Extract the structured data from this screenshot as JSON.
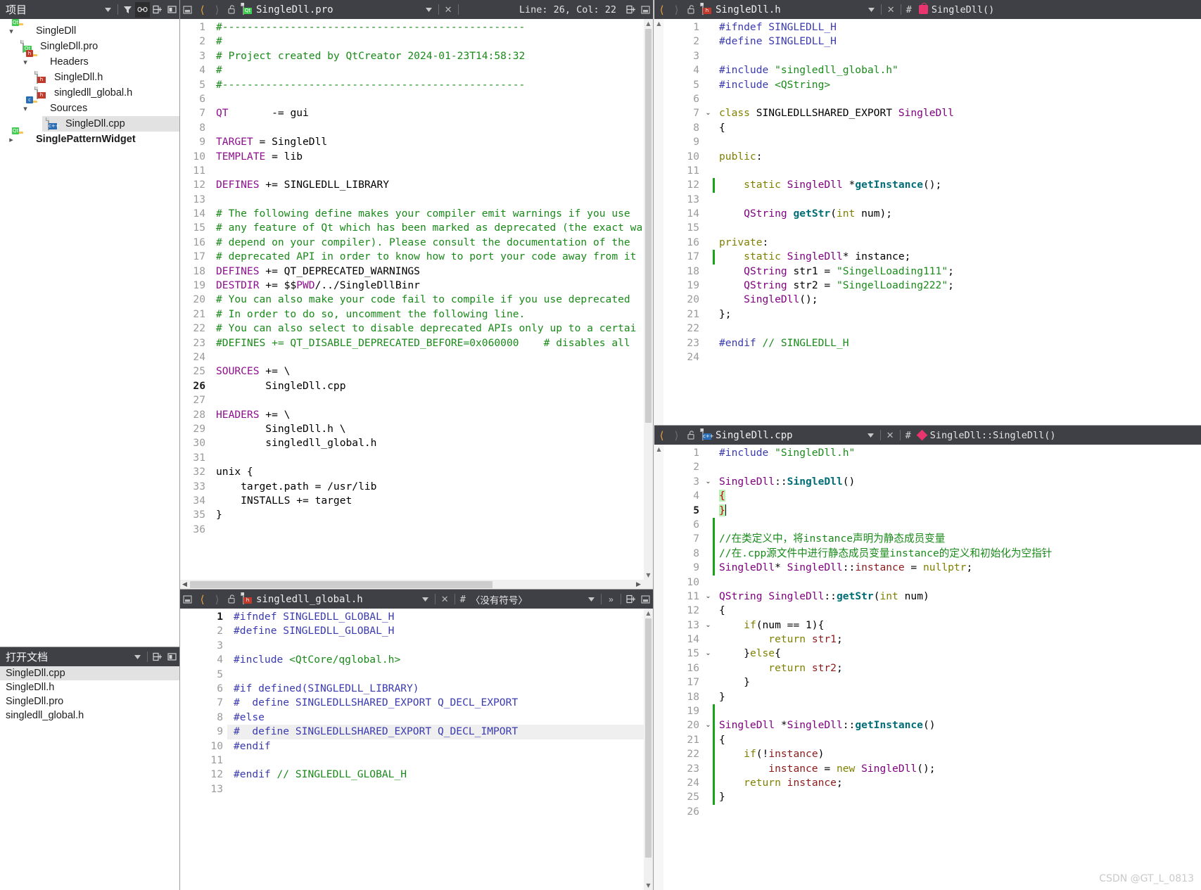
{
  "sidebar": {
    "title": "项目",
    "toolbar": [
      "chevron-down-icon",
      "filter-icon",
      "link-icon",
      "split-icon",
      "collapse-icon"
    ],
    "tree": [
      {
        "label": "SingleDll",
        "depth": 0,
        "caret": "v",
        "icon": "folder-qt",
        "selected": false,
        "bold": false
      },
      {
        "label": "SingleDll.pro",
        "depth": 1,
        "caret": "",
        "icon": "file-qt",
        "selected": false,
        "bold": false
      },
      {
        "label": "Headers",
        "depth": 1,
        "caret": "v",
        "icon": "folder-h",
        "selected": false,
        "bold": false
      },
      {
        "label": "SingleDll.h",
        "depth": 2,
        "caret": "",
        "icon": "file-h",
        "selected": false,
        "bold": false
      },
      {
        "label": "singledll_global.h",
        "depth": 2,
        "caret": "",
        "icon": "file-h",
        "selected": false,
        "bold": false
      },
      {
        "label": "Sources",
        "depth": 1,
        "caret": "v",
        "icon": "folder-cpp",
        "selected": false,
        "bold": false
      },
      {
        "label": "SingleDll.cpp",
        "depth": 2,
        "caret": "",
        "icon": "file-cpp",
        "selected": true,
        "bold": false
      },
      {
        "label": "SinglePatternWidget",
        "depth": 0,
        "caret": ">",
        "icon": "folder-qt",
        "selected": false,
        "bold": true
      }
    ]
  },
  "opendocs": {
    "title": "打开文档",
    "toolbar": [
      "chevron-down-icon",
      "split-icon"
    ],
    "items": [
      {
        "label": "SingleDll.cpp",
        "selected": true
      },
      {
        "label": "SingleDll.h",
        "selected": false
      },
      {
        "label": "SingleDll.pro",
        "selected": false
      },
      {
        "label": "singledll_global.h",
        "selected": false
      }
    ]
  },
  "editors": {
    "pro": {
      "filename": "SingleDll.pro",
      "icon": "qt-file-icon",
      "status": "Line: 26, Col: 22",
      "current_line": 26,
      "lines": [
        {
          "n": 1,
          "html": "<span class='c-cmt'>#-------------------------------------------------</span>"
        },
        {
          "n": 2,
          "html": "<span class='c-cmt'>#</span>"
        },
        {
          "n": 3,
          "html": "<span class='c-cmt'># Project created by QtCreator 2024-01-23T14:58:32</span>"
        },
        {
          "n": 4,
          "html": "<span class='c-cmt'>#</span>"
        },
        {
          "n": 5,
          "html": "<span class='c-cmt'>#-------------------------------------------------</span>"
        },
        {
          "n": 6,
          "html": ""
        },
        {
          "n": 7,
          "html": "<span class='c-pro'>QT</span>       -= gui"
        },
        {
          "n": 8,
          "html": ""
        },
        {
          "n": 9,
          "html": "<span class='c-pro'>TARGET</span> = SingleDll"
        },
        {
          "n": 10,
          "html": "<span class='c-pro'>TEMPLATE</span> = lib"
        },
        {
          "n": 11,
          "html": ""
        },
        {
          "n": 12,
          "html": "<span class='c-pro'>DEFINES</span> += SINGLEDLL_LIBRARY"
        },
        {
          "n": 13,
          "html": ""
        },
        {
          "n": 14,
          "html": "<span class='c-cmt'># The following define makes your compiler emit warnings if you use</span>"
        },
        {
          "n": 15,
          "html": "<span class='c-cmt'># any feature of Qt which has been marked as deprecated (the exact wa</span>"
        },
        {
          "n": 16,
          "html": "<span class='c-cmt'># depend on your compiler). Please consult the documentation of the</span>"
        },
        {
          "n": 17,
          "html": "<span class='c-cmt'># deprecated API in order to know how to port your code away from it</span>"
        },
        {
          "n": 18,
          "html": "<span class='c-pro'>DEFINES</span> += QT_DEPRECATED_WARNINGS"
        },
        {
          "n": 19,
          "html": "<span class='c-pro'>DESTDIR</span> += $$<span class='c-pro'>PWD</span>/../SingleDllBinr"
        },
        {
          "n": 20,
          "html": "<span class='c-cmt'># You can also make your code fail to compile if you use deprecated </span>"
        },
        {
          "n": 21,
          "html": "<span class='c-cmt'># In order to do so, uncomment the following line.</span>"
        },
        {
          "n": 22,
          "html": "<span class='c-cmt'># You can also select to disable deprecated APIs only up to a certai</span>"
        },
        {
          "n": 23,
          "html": "<span class='c-cmt'>#DEFINES += QT_DISABLE_DEPRECATED_BEFORE=0x060000    # disables all </span>"
        },
        {
          "n": 24,
          "html": ""
        },
        {
          "n": 25,
          "html": "<span class='c-pro'>SOURCES</span> += \\"
        },
        {
          "n": 26,
          "html": "        SingleDll.cpp"
        },
        {
          "n": 27,
          "html": ""
        },
        {
          "n": 28,
          "html": "<span class='c-pro'>HEADERS</span> += \\"
        },
        {
          "n": 29,
          "html": "        SingleDll.h \\"
        },
        {
          "n": 30,
          "html": "        singledll_global.h"
        },
        {
          "n": 31,
          "html": ""
        },
        {
          "n": 32,
          "html": "unix {"
        },
        {
          "n": 33,
          "html": "    target.path = /usr/lib"
        },
        {
          "n": 34,
          "html": "    INSTALLS += target"
        },
        {
          "n": 35,
          "html": "}"
        },
        {
          "n": 36,
          "html": ""
        }
      ]
    },
    "global_h": {
      "filename": "singledll_global.h",
      "icon": "h-file-icon",
      "symbol": "〈没有符号〉",
      "current_line": 1,
      "lines": [
        {
          "n": 1,
          "html": "<span class='c-pp'>#ifndef SINGLEDLL_GLOBAL_H</span>"
        },
        {
          "n": 2,
          "html": "<span class='c-pp'>#define SINGLEDLL_GLOBAL_H</span>"
        },
        {
          "n": 3,
          "html": ""
        },
        {
          "n": 4,
          "html": "<span class='c-pp'>#include </span><span class='c-str'>&lt;QtCore/qglobal.h&gt;</span>"
        },
        {
          "n": 5,
          "html": ""
        },
        {
          "n": 6,
          "html": "<span class='c-pp'>#if defined(SINGLEDLL_LIBRARY)</span>"
        },
        {
          "n": 7,
          "html": "<span class='c-pp'>#  define SINGLEDLLSHARED_EXPORT Q_DECL_EXPORT</span>"
        },
        {
          "n": 8,
          "html": "<span class='c-pp'>#else</span>"
        },
        {
          "n": 9,
          "html": "<span class='c-pp'>#  define SINGLEDLLSHARED_EXPORT Q_DECL_IMPORT</span>",
          "dim": true
        },
        {
          "n": 10,
          "html": "<span class='c-pp'>#endif</span>"
        },
        {
          "n": 11,
          "html": ""
        },
        {
          "n": 12,
          "html": "<span class='c-pp'>#endif </span><span class='c-cmt'>// SINGLEDLL_GLOBAL_H</span>"
        },
        {
          "n": 13,
          "html": ""
        }
      ]
    },
    "header": {
      "filename": "SingleDll.h",
      "icon": "h-file-icon",
      "symbol": "SingleDll()",
      "symbol_icon": "class-lock-icon",
      "lines": [
        {
          "n": 1,
          "html": "<span class='c-pp'>#ifndef SINGLEDLL_H</span>"
        },
        {
          "n": 2,
          "html": "<span class='c-pp'>#define SINGLEDLL_H</span>"
        },
        {
          "n": 3,
          "html": ""
        },
        {
          "n": 4,
          "html": "<span class='c-pp'>#include </span><span class='c-str'>\"singledll_global.h\"</span>"
        },
        {
          "n": 5,
          "html": "<span class='c-pp'>#include </span><span class='c-str'>&lt;QString&gt;</span>"
        },
        {
          "n": 6,
          "html": ""
        },
        {
          "n": 7,
          "html": "<span class='c-kw'>class</span> SINGLEDLLSHARED_EXPORT <span class='c-type'>SingleDll</span>",
          "fold": "v"
        },
        {
          "n": 8,
          "html": "{"
        },
        {
          "n": 9,
          "html": ""
        },
        {
          "n": 10,
          "html": "<span class='c-kw'>public</span>:"
        },
        {
          "n": 11,
          "html": ""
        },
        {
          "n": 12,
          "html": "    <span class='c-kw'>static</span> <span class='c-type'>SingleDll</span> *<span class='c-fn'>getInstance</span>();",
          "chg": true
        },
        {
          "n": 13,
          "html": ""
        },
        {
          "n": 14,
          "html": "    <span class='c-type'>QString</span> <span class='c-fn'>getStr</span>(<span class='c-kw'>int</span> num);"
        },
        {
          "n": 15,
          "html": ""
        },
        {
          "n": 16,
          "html": "<span class='c-kw'>private</span>:"
        },
        {
          "n": 17,
          "html": "    <span class='c-kw'>static</span> <span class='c-type'>SingleDll</span>* instance;",
          "chg": true
        },
        {
          "n": 18,
          "html": "    <span class='c-type'>QString</span> str1 = <span class='c-str'>\"SingelLoading111\"</span>;"
        },
        {
          "n": 19,
          "html": "    <span class='c-type'>QString</span> str2 = <span class='c-str'>\"SingelLoading222\"</span>;"
        },
        {
          "n": 20,
          "html": "    <span class='c-type'>SingleDll</span>();"
        },
        {
          "n": 21,
          "html": "};"
        },
        {
          "n": 22,
          "html": ""
        },
        {
          "n": 23,
          "html": "<span class='c-pp'>#endif </span><span class='c-cmt'>// SINGLEDLL_H</span>"
        },
        {
          "n": 24,
          "html": ""
        }
      ]
    },
    "source": {
      "filename": "SingleDll.cpp",
      "icon": "cpp-file-icon",
      "symbol": "SingleDll::SingleDll()",
      "symbol_icon": "diamond-icon",
      "current_line": 5,
      "lines": [
        {
          "n": 1,
          "html": "<span class='c-pp'>#include </span><span class='c-str'>\"SingleDll.h\"</span>"
        },
        {
          "n": 2,
          "html": ""
        },
        {
          "n": 3,
          "html": "<span class='c-type'>SingleDll</span>::<span class='c-fn'>SingleDll</span>()",
          "fold": "v"
        },
        {
          "n": 4,
          "html": "<span class='brace'>{</span>"
        },
        {
          "n": 5,
          "html": "<span class='brace'>}</span><span class='cursor'></span>"
        },
        {
          "n": 6,
          "html": "",
          "chg": true
        },
        {
          "n": 7,
          "html": "<span class='c-cmt'>//在类定义中，将instance声明为静态成员变量</span>",
          "chg": true
        },
        {
          "n": 8,
          "html": "<span class='c-cmt'>//在.cpp源文件中进行静态成员变量instance的定义和初始化为空指针</span>",
          "chg": true
        },
        {
          "n": 9,
          "html": "<span class='c-type'>SingleDll</span>* <span class='c-type'>SingleDll</span>::<span class='c-var'>instance</span> = <span class='c-kw'>nullptr</span>;",
          "chg": true
        },
        {
          "n": 10,
          "html": ""
        },
        {
          "n": 11,
          "html": "<span class='c-type'>QString</span> <span class='c-type'>SingleDll</span>::<span class='c-fn'>getStr</span>(<span class='c-kw'>int</span> num)",
          "fold": "v"
        },
        {
          "n": 12,
          "html": "{"
        },
        {
          "n": 13,
          "html": "    <span class='c-kw'>if</span>(num == 1){",
          "fold": "v"
        },
        {
          "n": 14,
          "html": "        <span class='c-kw'>return</span> <span class='c-var'>str1</span>;"
        },
        {
          "n": 15,
          "html": "    }<span class='c-kw'>else</span>{",
          "fold": "v"
        },
        {
          "n": 16,
          "html": "        <span class='c-kw'>return</span> <span class='c-var'>str2</span>;"
        },
        {
          "n": 17,
          "html": "    }"
        },
        {
          "n": 18,
          "html": "}"
        },
        {
          "n": 19,
          "html": "",
          "chg": true
        },
        {
          "n": 20,
          "html": "<span class='c-type'>SingleDll</span> *<span class='c-type'>SingleDll</span>::<span class='c-fn'>getInstance</span>()",
          "fold": "v",
          "chg": true
        },
        {
          "n": 21,
          "html": "{",
          "chg": true
        },
        {
          "n": 22,
          "html": "    <span class='c-kw'>if</span>(!<span class='c-var'>instance</span>)",
          "chg": true
        },
        {
          "n": 23,
          "html": "        <span class='c-var'>instance</span> = <span class='c-kw'>new</span> <span class='c-type'>SingleDll</span>();",
          "chg": true
        },
        {
          "n": 24,
          "html": "    <span class='c-kw'>return</span> <span class='c-var'>instance</span>;",
          "chg": true
        },
        {
          "n": 25,
          "html": "}",
          "chg": true
        },
        {
          "n": 26,
          "html": ""
        }
      ]
    }
  },
  "watermark": "CSDN @GT_L_0813",
  "colors": {
    "bar_bg": "#3f3f46",
    "selection": "#e2e2e2",
    "comment": "#1a8a1a",
    "preprocessor": "#3a3ab0",
    "type": "#800080",
    "keyword": "#808000",
    "function": "#006d77",
    "qmake_var": "#8e0f8e",
    "change_marker": "#19a319"
  }
}
